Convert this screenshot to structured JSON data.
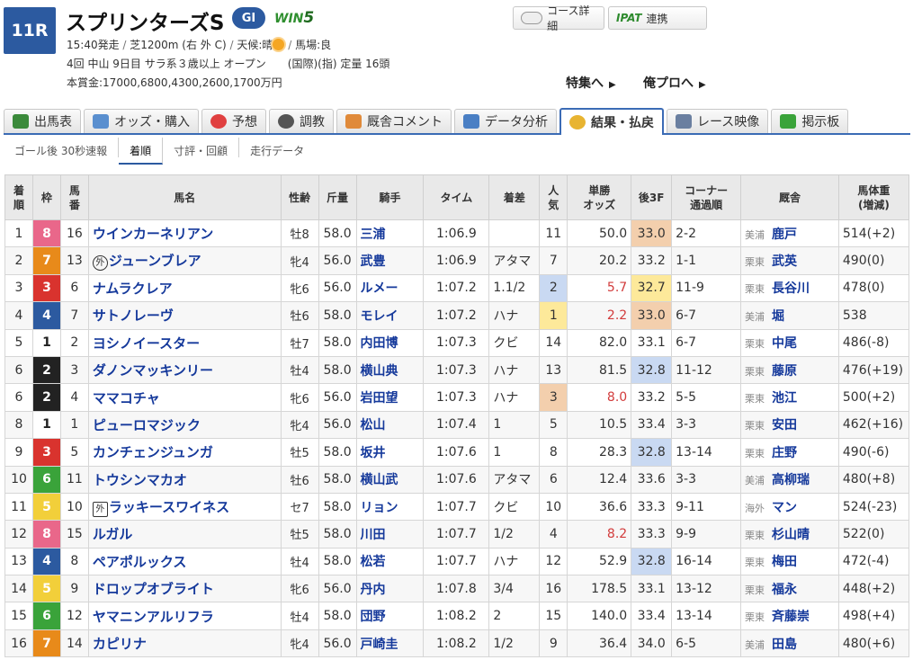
{
  "race": {
    "number": "11R",
    "name": "スプリンターズS",
    "grade": "GI",
    "win5_prefix": "WIN",
    "win5_num": "5",
    "line1_start": "15:40発走",
    "line1_course": "芝1200m (右 外 C)",
    "line1_weather_label": "天候:晴",
    "line1_track": "馬場:良",
    "line2": "4回 中山 9日目 サラ系３歳以上 オープン　　(国際)(指) 定量 16頭",
    "line3": "本賞金:17000,6800,4300,2600,1700万円"
  },
  "buttons": {
    "course": "コース詳細",
    "ipat": "IPAT",
    "ipat_suffix": "連携"
  },
  "links": {
    "tokushu": "特集へ",
    "orepro": "俺プロへ",
    "arrow": "▶"
  },
  "tabs": [
    "出馬表",
    "オッズ・購入",
    "予想",
    "調教",
    "厩舎コメント",
    "データ分析",
    "結果・払戻",
    "レース映像",
    "掲示板"
  ],
  "subtabs": [
    "ゴール後 30秒速報",
    "着順",
    "寸評・回顧",
    "走行データ"
  ],
  "table": {
    "headers": {
      "rank": "着\n順",
      "waku": "枠",
      "umaban": "馬\n番",
      "name": "馬名",
      "sexage": "性齢",
      "weight": "斤量",
      "jockey": "騎手",
      "time": "タイム",
      "margin": "着差",
      "pop": "人\n気",
      "odds": "単勝\nオッズ",
      "last3f": "後3F",
      "corner": "コーナー\n通過順",
      "stable": "厩舎",
      "bodyweight": "馬体重\n(増減)"
    },
    "rows": [
      {
        "rank": "1",
        "waku": "8",
        "umaban": "16",
        "mark": "",
        "name": "ウインカーネリアン",
        "sexage": "牡8",
        "weight": "58.0",
        "jockey": "三浦",
        "time": "1:06.9",
        "margin": "",
        "pop": "11",
        "odds": "50.0",
        "last3f": "33.0",
        "corner": "2-2",
        "area": "美浦",
        "trainer": "鹿戸",
        "bw": "514(+2)"
      },
      {
        "rank": "2",
        "waku": "7",
        "umaban": "13",
        "mark": "外",
        "name": "ジューンブレア",
        "sexage": "牝4",
        "weight": "56.0",
        "jockey": "武豊",
        "time": "1:06.9",
        "margin": "アタマ",
        "pop": "7",
        "odds": "20.2",
        "last3f": "33.2",
        "corner": "1-1",
        "area": "栗東",
        "trainer": "武英",
        "bw": "490(0)"
      },
      {
        "rank": "3",
        "waku": "3",
        "umaban": "6",
        "mark": "",
        "name": "ナムラクレア",
        "sexage": "牝6",
        "weight": "56.0",
        "jockey": "ルメー",
        "time": "1:07.2",
        "margin": "1.1/2",
        "pop": "2",
        "odds": "5.7",
        "last3f": "32.7",
        "corner": "11-9",
        "area": "栗東",
        "trainer": "長谷川",
        "bw": "478(0)"
      },
      {
        "rank": "4",
        "waku": "4",
        "umaban": "7",
        "mark": "",
        "name": "サトノレーヴ",
        "sexage": "牡6",
        "weight": "58.0",
        "jockey": "モレイ",
        "time": "1:07.2",
        "margin": "ハナ",
        "pop": "1",
        "odds": "2.2",
        "last3f": "33.0",
        "corner": "6-7",
        "area": "美浦",
        "trainer": "堀",
        "bw": "538"
      },
      {
        "rank": "5",
        "waku": "1",
        "umaban": "2",
        "mark": "",
        "name": "ヨシノイースター",
        "sexage": "牡7",
        "weight": "58.0",
        "jockey": "内田博",
        "time": "1:07.3",
        "margin": "クビ",
        "pop": "14",
        "odds": "82.0",
        "last3f": "33.1",
        "corner": "6-7",
        "area": "栗東",
        "trainer": "中尾",
        "bw": "486(-8)"
      },
      {
        "rank": "6",
        "waku": "2",
        "umaban": "3",
        "mark": "",
        "name": "ダノンマッキンリー",
        "sexage": "牡4",
        "weight": "58.0",
        "jockey": "横山典",
        "time": "1:07.3",
        "margin": "ハナ",
        "pop": "13",
        "odds": "81.5",
        "last3f": "32.8",
        "corner": "11-12",
        "area": "栗東",
        "trainer": "藤原",
        "bw": "476(+19)"
      },
      {
        "rank": "6",
        "waku": "2",
        "umaban": "4",
        "mark": "",
        "name": "ママコチャ",
        "sexage": "牝6",
        "weight": "56.0",
        "jockey": "岩田望",
        "time": "1:07.3",
        "margin": "ハナ",
        "pop": "3",
        "odds": "8.0",
        "last3f": "33.2",
        "corner": "5-5",
        "area": "栗東",
        "trainer": "池江",
        "bw": "500(+2)"
      },
      {
        "rank": "8",
        "waku": "1",
        "umaban": "1",
        "mark": "",
        "name": "ピューロマジック",
        "sexage": "牝4",
        "weight": "56.0",
        "jockey": "松山",
        "time": "1:07.4",
        "margin": "1",
        "pop": "5",
        "odds": "10.5",
        "last3f": "33.4",
        "corner": "3-3",
        "area": "栗東",
        "trainer": "安田",
        "bw": "462(+16)"
      },
      {
        "rank": "9",
        "waku": "3",
        "umaban": "5",
        "mark": "",
        "name": "カンチェンジュンガ",
        "sexage": "牡5",
        "weight": "58.0",
        "jockey": "坂井",
        "time": "1:07.6",
        "margin": "1",
        "pop": "8",
        "odds": "28.3",
        "last3f": "32.8",
        "corner": "13-14",
        "area": "栗東",
        "trainer": "庄野",
        "bw": "490(-6)"
      },
      {
        "rank": "10",
        "waku": "6",
        "umaban": "11",
        "mark": "",
        "name": "トウシンマカオ",
        "sexage": "牡6",
        "weight": "58.0",
        "jockey": "横山武",
        "time": "1:07.6",
        "margin": "アタマ",
        "pop": "6",
        "odds": "12.4",
        "last3f": "33.6",
        "corner": "3-3",
        "area": "美浦",
        "trainer": "高柳瑞",
        "bw": "480(+8)"
      },
      {
        "rank": "11",
        "waku": "5",
        "umaban": "10",
        "mark": "外",
        "name": "ラッキースワイネス",
        "sexage": "セ7",
        "weight": "58.0",
        "jockey": "リョン",
        "time": "1:07.7",
        "margin": "クビ",
        "pop": "10",
        "odds": "36.6",
        "last3f": "33.3",
        "corner": "9-11",
        "area": "海外",
        "trainer": "マン",
        "bw": "524(-23)"
      },
      {
        "rank": "12",
        "waku": "8",
        "umaban": "15",
        "mark": "",
        "name": "ルガル",
        "sexage": "牡5",
        "weight": "58.0",
        "jockey": "川田",
        "time": "1:07.7",
        "margin": "1/2",
        "pop": "4",
        "odds": "8.2",
        "last3f": "33.3",
        "corner": "9-9",
        "area": "栗東",
        "trainer": "杉山晴",
        "bw": "522(0)"
      },
      {
        "rank": "13",
        "waku": "4",
        "umaban": "8",
        "mark": "",
        "name": "ペアポルックス",
        "sexage": "牡4",
        "weight": "58.0",
        "jockey": "松若",
        "time": "1:07.7",
        "margin": "ハナ",
        "pop": "12",
        "odds": "52.9",
        "last3f": "32.8",
        "corner": "16-14",
        "area": "栗東",
        "trainer": "梅田",
        "bw": "472(-4)"
      },
      {
        "rank": "14",
        "waku": "5",
        "umaban": "9",
        "mark": "",
        "name": "ドロップオブライト",
        "sexage": "牝6",
        "weight": "56.0",
        "jockey": "丹内",
        "time": "1:07.8",
        "margin": "3/4",
        "pop": "16",
        "odds": "178.5",
        "last3f": "33.1",
        "corner": "13-12",
        "area": "栗東",
        "trainer": "福永",
        "bw": "448(+2)"
      },
      {
        "rank": "15",
        "waku": "6",
        "umaban": "12",
        "mark": "",
        "name": "ヤマニンアルリフラ",
        "sexage": "牡4",
        "weight": "58.0",
        "jockey": "団野",
        "time": "1:08.2",
        "margin": "2",
        "pop": "15",
        "odds": "140.0",
        "last3f": "33.4",
        "corner": "13-14",
        "area": "栗東",
        "trainer": "斉藤崇",
        "bw": "498(+4)"
      },
      {
        "rank": "16",
        "waku": "7",
        "umaban": "14",
        "mark": "",
        "name": "カピリナ",
        "sexage": "牝4",
        "weight": "56.0",
        "jockey": "戸崎圭",
        "time": "1:08.2",
        "margin": "1/2",
        "pop": "9",
        "odds": "36.4",
        "last3f": "34.0",
        "corner": "6-5",
        "area": "美浦",
        "trainer": "田島",
        "bw": "480(+6)"
      }
    ]
  },
  "colors": {
    "waku": {
      "1": "#ffffff",
      "2": "#222222",
      "3": "#d9332e",
      "4": "#2c5aa0",
      "5": "#f2cf3a",
      "6": "#3aa33a",
      "7": "#e88a1a",
      "8": "#e9678a"
    },
    "waku_text": {
      "1": "#222222",
      "5": "#ffffff"
    },
    "last3f_1st": "#fde99a",
    "last3f_2nd": "#c9d9f2",
    "last3f_3rd": "#f3cfad"
  },
  "highlights": {
    "last3f_rank1": [
      "3"
    ],
    "last3f_rank2": [
      "6",
      "9",
      "13"
    ],
    "last3f_rank3": [
      "1",
      "4"
    ]
  }
}
